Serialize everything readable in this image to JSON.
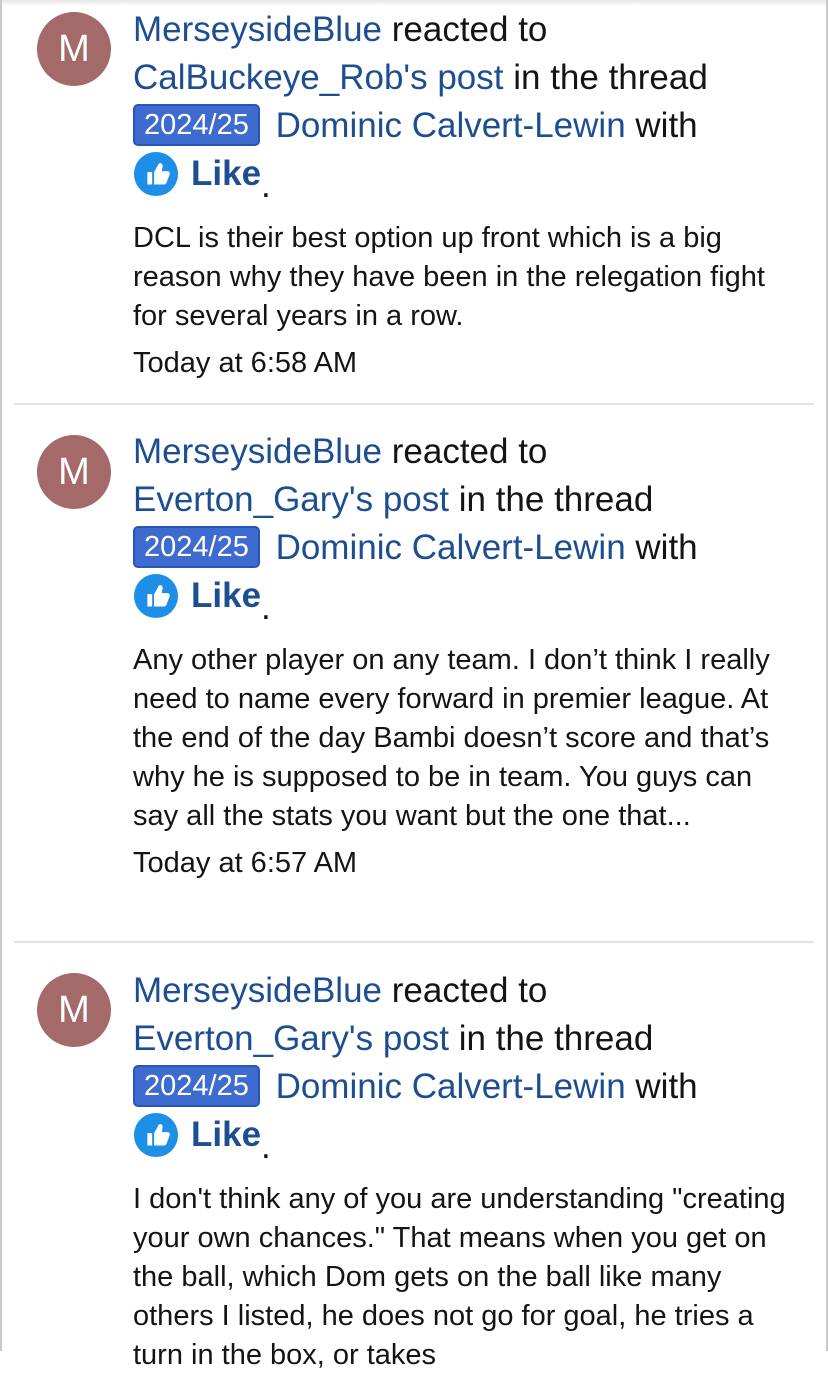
{
  "alerts": [
    {
      "avatar_letter": "M",
      "username": "MerseysideBlue",
      "action_text": "reacted to",
      "post_link": "CalBuckeye_Rob's post",
      "thread_text": "in the thread",
      "prefix": "2024/25",
      "thread_title": "Dominic Calvert-Lewin",
      "with_text": "with",
      "reaction": "Like",
      "period": ".",
      "snippet": "DCL is their best option up front which is a big reason why they have been in the relegation fight for several years in a row.",
      "time": "Today at 6:58 AM"
    },
    {
      "avatar_letter": "M",
      "username": "MerseysideBlue",
      "action_text": "reacted to",
      "post_link": "Everton_Gary's post",
      "thread_text": "in the thread",
      "prefix": "2024/25",
      "thread_title": "Dominic Calvert-Lewin",
      "with_text": "with",
      "reaction": "Like",
      "period": ".",
      "snippet": "Any other player on any team. I don’t think I really need to name every forward in premier league. At the end of the day Bambi doesn’t score and that’s why he is supposed to be in team. You guys can say all the stats you want but the one that...",
      "time": "Today at 6:57 AM"
    },
    {
      "avatar_letter": "M",
      "username": "MerseysideBlue",
      "action_text": "reacted to",
      "post_link": "Everton_Gary's post",
      "thread_text": "in the thread",
      "prefix": "2024/25",
      "thread_title": "Dominic Calvert-Lewin",
      "with_text": "with",
      "reaction": "Like",
      "period": ".",
      "snippet": "I don't think any of you are understanding \"creating your own chances.\" That means when you get on the ball, which Dom gets on the ball like many others I listed, he does not go for goal, he tries a turn in the box, or takes",
      "time": ""
    }
  ],
  "colors": {
    "link": "#1d4e92",
    "prefix_bg": "#3e6bcf",
    "avatar_bg": "#a46a6a",
    "like_icon": "#1e8fe6"
  },
  "icons": {
    "reaction_icon": "thumbs-up-icon"
  }
}
